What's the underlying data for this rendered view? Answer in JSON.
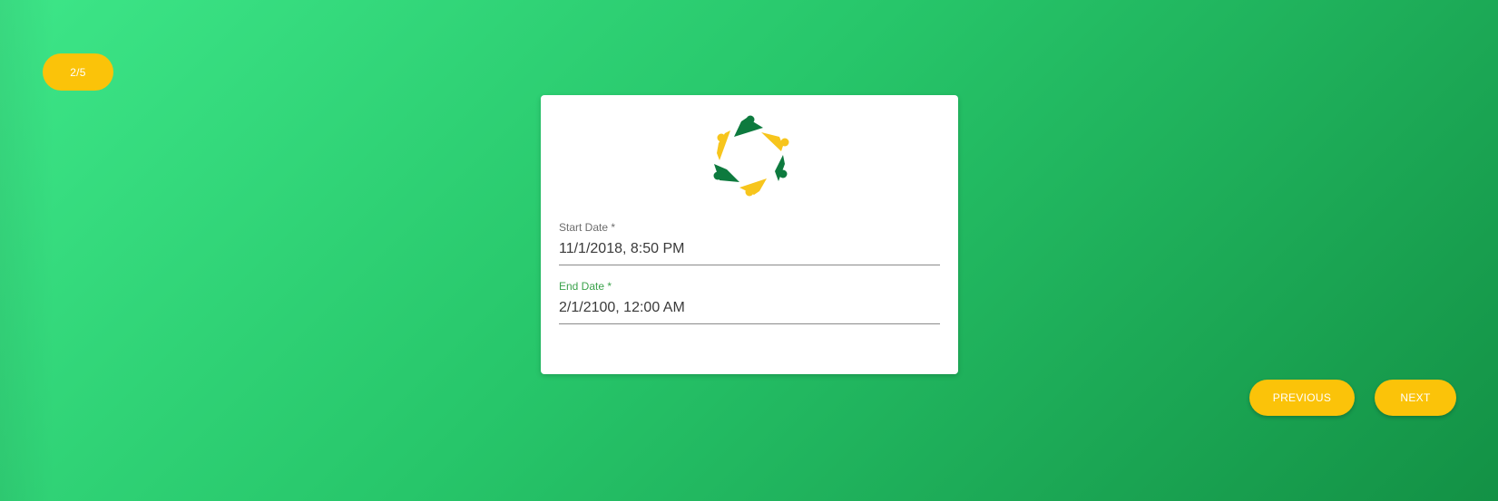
{
  "wizard": {
    "step_indicator": "2/5"
  },
  "logo": {
    "colors": [
      "#f7c51c",
      "#0d7a3e"
    ]
  },
  "form": {
    "start_date": {
      "label": "Start Date *",
      "value": "11/1/2018, 8:50 PM"
    },
    "end_date": {
      "label": "End Date *",
      "value": "2/1/2100, 12:00 AM"
    }
  },
  "navigation": {
    "previous_label": "PREVIOUS",
    "next_label": "NEXT"
  },
  "colors": {
    "accent": "#fbc309",
    "background_start": "#3de688",
    "background_end": "#139145",
    "focused_label": "#3ba24b"
  }
}
